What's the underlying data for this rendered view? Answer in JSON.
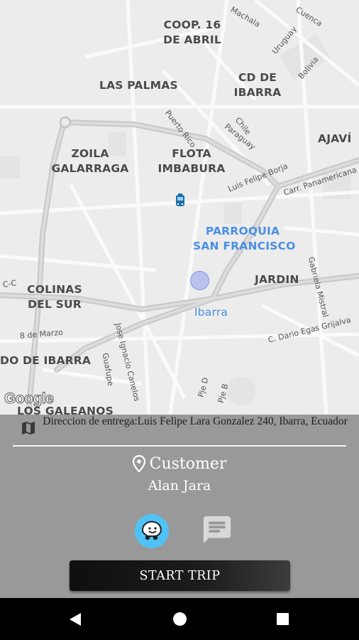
{
  "map": {
    "areas": [
      "COOP. 16\nDE ABRIL",
      "LAS PALMAS",
      "CD DE\nIBARRA",
      "AJAVÍ",
      "ZOILA\nGALARRAGA",
      "FLOTA\nIMBABURA",
      "PARROQUIA\nSAN FRANCISCO",
      "JARDIN",
      "COLINAS\nDEL SUR",
      "DO DE IBARRA",
      "LOS GALEANOS"
    ],
    "city": "Ibarra",
    "streets": [
      "Machala",
      "Cuenca",
      "Uruguay",
      "Bolivia",
      "Puerto Rico",
      "Chile",
      "Paraguay",
      "Luis Felipe Borja",
      "Carr. Panamericana",
      "Gabriela Mistral",
      "C. Dario Egas Grijalva",
      "Jose Ignacio Canelos",
      "Guafupe",
      "8 de Marzo",
      "C-C",
      "Pje D",
      "Pje B"
    ],
    "attribution": "Google"
  },
  "panel": {
    "address": "Direccion de entrega:Luis Felipe Lara Gonzalez 240, Ibarra, Ecuador",
    "customer_title": "Customer",
    "customer_name": "Alan Jara",
    "start_button": "START TRIP"
  },
  "colors": {
    "panel_bg": "#999999",
    "waze_blue": "#4fc3f7",
    "button_dark": "#1c1c1c"
  },
  "icons": [
    "map-icon",
    "location-pin-icon",
    "waze-icon",
    "chat-icon",
    "bus-marker-icon",
    "current-location-icon",
    "back-icon",
    "home-icon",
    "recents-icon"
  ]
}
